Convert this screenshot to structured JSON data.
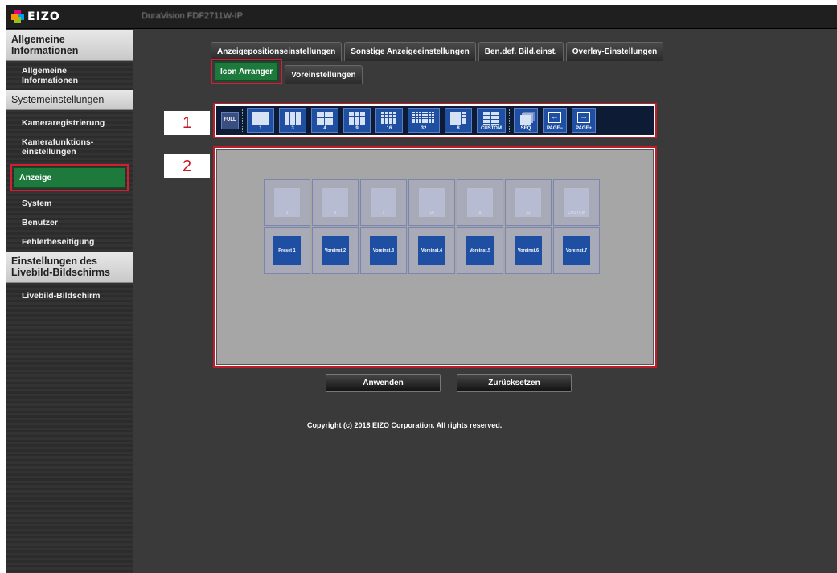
{
  "brand": {
    "logo_text": "EIZO",
    "model": "DuraVision FDF2711W-IP"
  },
  "sidebar": {
    "sec1": "Allgemeine Informationen",
    "item1": "Allgemeine Informationen",
    "sec2": "Systemeinstellungen",
    "item_kamera": "Kameraregistrierung",
    "item_funk": "Kamerafunktions-einstellungen",
    "item_anzeige": "Anzeige",
    "item_system": "System",
    "item_benutzer": "Benutzer",
    "item_fehler": "Fehlerbeseitigung",
    "sec3": "Einstellungen des Livebild-Bildschirms",
    "item_live": "Livebild-Bildschirm"
  },
  "tabs": {
    "row1": [
      "Anzeigepositionseinstellungen",
      "Sonstige Anzeigeeinstellungen",
      "Ben.def. Bild.einst.",
      "Overlay-Einstellungen"
    ],
    "active": "Icon Arranger",
    "other": "Voreinstellungen"
  },
  "callouts": {
    "one": "1",
    "two": "2"
  },
  "toolbar": {
    "full": "FULL",
    "btn1": "1",
    "btn3": "3",
    "btn4": "4",
    "btn9": "9",
    "btn16": "16",
    "btn32": "32",
    "btn8": "8",
    "custom": "CUSTOM",
    "seq": "SEQ",
    "page_minus": "PAGE−",
    "page_plus": "PAGE+"
  },
  "grid": {
    "row1": [
      "3",
      "4",
      "9",
      "16",
      "8",
      "32",
      "CUSTOM"
    ],
    "row2": [
      "Preset 1",
      "Voreinst.2",
      "Voreinst.3",
      "Voreinst.4",
      "Voreinst.5",
      "Voreinst.6",
      "Voreinst.7"
    ]
  },
  "buttons": {
    "apply": "Anwenden",
    "reset": "Zurücksetzen"
  },
  "footer": {
    "copyright": "Copyright (c) 2018 EIZO Corporation. All rights reserved."
  },
  "colors": {
    "accent_green": "#1e7a3c",
    "highlight_red": "#c21a28",
    "icon_blue": "#1e4fa3"
  }
}
